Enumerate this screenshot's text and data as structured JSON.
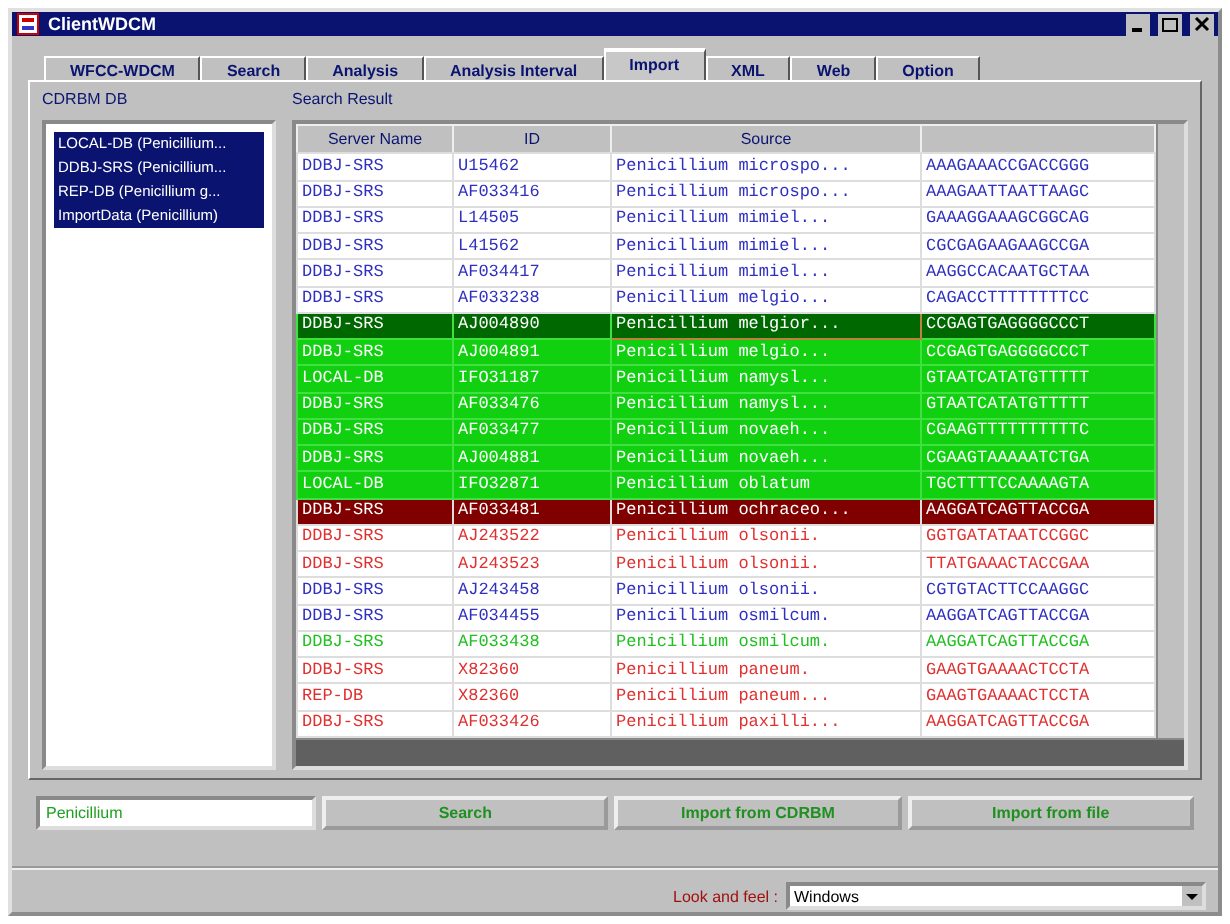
{
  "window": {
    "title": "ClientWDCM"
  },
  "tabs": [
    {
      "label": "WFCC-WDCM",
      "selected": false
    },
    {
      "label": "Search",
      "selected": false
    },
    {
      "label": "Analysis",
      "selected": false
    },
    {
      "label": "Analysis Interval",
      "selected": false
    },
    {
      "label": "Import",
      "selected": true
    },
    {
      "label": "XML",
      "selected": false
    },
    {
      "label": "Web",
      "selected": false
    },
    {
      "label": "Option",
      "selected": false
    }
  ],
  "db_panel": {
    "label": "CDRBM DB",
    "items": [
      {
        "label": "LOCAL-DB (Penicillium...",
        "selected": true
      },
      {
        "label": "DDBJ-SRS (Penicillium...",
        "selected": true
      },
      {
        "label": "REP-DB (Penicillium g...",
        "selected": true
      },
      {
        "label": "ImportData (Penicillium)",
        "selected": true
      }
    ]
  },
  "results": {
    "label": "Search Result",
    "columns": [
      "Server Name",
      "ID",
      "Source"
    ],
    "rows": [
      {
        "server": "DDBJ-SRS",
        "id": "U15462",
        "source": "Penicillium microspo...",
        "sequence": "AAAGAAACCGACCGGG",
        "kind": "plain",
        "color": "#3030c0",
        "selected": false
      },
      {
        "server": "DDBJ-SRS",
        "id": "AF033416",
        "source": "Penicillium microspo...",
        "sequence": "AAAGAATTAATTAAGC",
        "kind": "plain",
        "color": "#3030c0",
        "selected": false
      },
      {
        "server": "DDBJ-SRS",
        "id": "L14505",
        "source": "Penicillium mimiel...",
        "sequence": "GAAAGGAAAGCGGCAG",
        "kind": "plain",
        "color": "#3030c0",
        "selected": false
      },
      {
        "server": "DDBJ-SRS",
        "id": "L41562",
        "source": "Penicillium mimiel...",
        "sequence": "CGCGAGAAGAAGCCGA",
        "kind": "plain",
        "color": "#3030c0",
        "selected": false
      },
      {
        "server": "DDBJ-SRS",
        "id": "AF034417",
        "source": "Penicillium mimiel...",
        "sequence": "AAGGCCACAATGCTAA",
        "kind": "plain",
        "color": "#3030c0",
        "selected": false
      },
      {
        "server": "DDBJ-SRS",
        "id": "AF033238",
        "source": "Penicillium melgio...",
        "sequence": "CAGACCTTTTTTTTCC",
        "kind": "plain",
        "color": "#3030c0",
        "selected": false
      },
      {
        "server": "DDBJ-SRS",
        "id": "AJ004890",
        "source": "Penicillium melgior...",
        "sequence": "CCGAGTGAGGGGCCCT",
        "kind": "green",
        "selected": true
      },
      {
        "server": "DDBJ-SRS",
        "id": "AJ004891",
        "source": "Penicillium melgio...",
        "sequence": "CCGAGTGAGGGGCCCT",
        "kind": "green",
        "selected": false
      },
      {
        "server": "LOCAL-DB",
        "id": "IFO31187",
        "source": "Penicillium namysl...",
        "sequence": "GTAATCATATGTTTTT",
        "kind": "green",
        "selected": false
      },
      {
        "server": "DDBJ-SRS",
        "id": "AF033476",
        "source": "Penicillium namysl...",
        "sequence": "GTAATCATATGTTTTT",
        "kind": "green",
        "selected": false
      },
      {
        "server": "DDBJ-SRS",
        "id": "AF033477",
        "source": "Penicillium novaeh...",
        "sequence": "CGAAGTTTTTTTTTTC",
        "kind": "green",
        "selected": false
      },
      {
        "server": "DDBJ-SRS",
        "id": "AJ004881",
        "source": "Penicillium novaeh...",
        "sequence": "CGAAGTAAAAATCTGA",
        "kind": "green",
        "selected": false
      },
      {
        "server": "LOCAL-DB",
        "id": "IFO32871",
        "source": "Penicillium oblatum",
        "sequence": "TGCTTTTCCAAAAGTA",
        "kind": "green",
        "selected": false
      },
      {
        "server": "DDBJ-SRS",
        "id": "AF033481",
        "source": "Penicillium ochraceo...",
        "sequence": "AAGGATCAGTTACCGA",
        "kind": "dark-red",
        "selected": false
      },
      {
        "server": "DDBJ-SRS",
        "id": "AJ243522",
        "source": "Penicillium olsonii.",
        "sequence": "GGTGATATAATCCGGC",
        "kind": "plain",
        "color": "#e03030",
        "selected": false
      },
      {
        "server": "DDBJ-SRS",
        "id": "AJ243523",
        "source": "Penicillium olsonii.",
        "sequence": "TTATGAAACTACCGAA",
        "kind": "plain",
        "color": "#e03030",
        "selected": false
      },
      {
        "server": "DDBJ-SRS",
        "id": "AJ243458",
        "source": "Penicillium olsonii.",
        "sequence": "CGTGTACTTCCAAGGC",
        "kind": "plain",
        "color": "#3030c0",
        "selected": false
      },
      {
        "server": "DDBJ-SRS",
        "id": "AF034455",
        "source": "Penicillium osmilcum.",
        "sequence": "AAGGATCAGTTACCGA",
        "kind": "plain",
        "color": "#3030c0",
        "selected": false
      },
      {
        "server": "DDBJ-SRS",
        "id": "AF033438",
        "source": "Penicillium osmilcum.",
        "sequence": "AAGGATCAGTTACCGA",
        "kind": "plain",
        "color": "#20c020",
        "selected": false
      },
      {
        "server": "DDBJ-SRS",
        "id": "X82360",
        "source": "Penicillium paneum.",
        "sequence": "GAAGTGAAAACTCCTA",
        "kind": "plain",
        "color": "#e03030",
        "selected": false
      },
      {
        "server": "REP-DB",
        "id": "X82360",
        "source": "Penicillium paneum...",
        "sequence": "GAAGTGAAAACTCCTA",
        "kind": "plain",
        "color": "#e03030",
        "selected": false
      },
      {
        "server": "DDBJ-SRS",
        "id": "AF033426",
        "source": "Penicillium paxilli...",
        "sequence": "AAGGATCAGTTACCGA",
        "kind": "plain",
        "color": "#e03030",
        "selected": false
      }
    ]
  },
  "search": {
    "value": "Penicillium"
  },
  "buttons": [
    "Search",
    "Import from CDRBM",
    "Import from file"
  ],
  "look_and_feel": {
    "label": "Look and feel :",
    "value": "Windows"
  }
}
